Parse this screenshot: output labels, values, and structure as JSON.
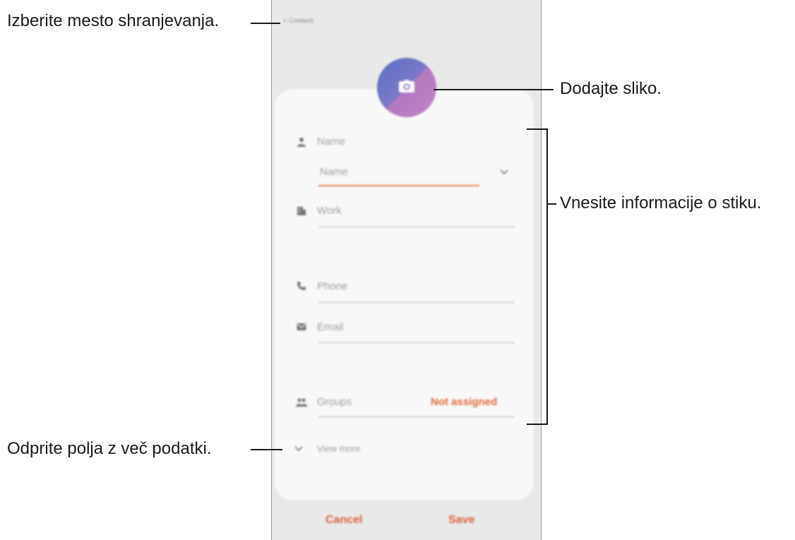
{
  "screen": {
    "back_label": "< Contacts",
    "fields": {
      "name_label": "Name",
      "name_input_placeholder": "Name",
      "work_label": "Work",
      "phone_label": "Phone",
      "email_label": "Email",
      "groups_label": "Groups",
      "groups_value": "Not assigned",
      "view_more_label": "View more"
    },
    "buttons": {
      "cancel": "Cancel",
      "save": "Save"
    }
  },
  "callouts": {
    "storage": "Izberite mesto shranjevanja.",
    "photo": "Dodajte sliko.",
    "info": "Vnesite informacije o stiku.",
    "more": "Odprite polja z več podatki."
  },
  "colors": {
    "accent": "#e06a3c",
    "avatar_top": "#5a6fc4",
    "avatar_bottom": "#c583c4"
  }
}
